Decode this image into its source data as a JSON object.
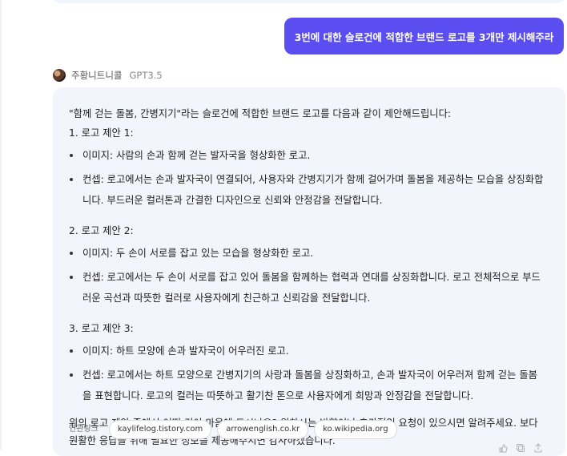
{
  "user_message": "3번에 대한 슬로건에 적합한 브랜드 로고를 3개만 제시해주라",
  "assistant": {
    "name": "주황니트니콜",
    "model": "GPT3.5"
  },
  "response": {
    "intro": "\"함께 걷는 돌봄, 간병지기\"라는 슬로건에 적합한 브랜드 로고를 다음과 같이 제안해드립니다:",
    "sections": [
      {
        "title": "1. 로고 제안 1:",
        "image": "이미지: 사람의 손과 함께 걷는 발자국을 형상화한 로고.",
        "concept": "컨셉: 로고에서는 손과 발자국이 연결되어, 사용자와 간병지기가 함께 걸어가며 돌봄을 제공하는 모습을 상징화합니다. 부드러운 컬러톤과 간결한 디자인으로 신뢰와 안정감을 전달합니다."
      },
      {
        "title": "2. 로고 제안 2:",
        "image": "이미지: 두 손이 서로를 잡고 있는 모습을 형상화한 로고.",
        "concept": "컨셉: 로고에서는 두 손이 서로를 잡고 있어 돌봄을 함께하는 협력과 연대를 상징화합니다. 로고 전체적으로 부드러운 곡선과 따뜻한 컬러로 사용자에게 친근하고 신뢰감을 전달합니다."
      },
      {
        "title": "3. 로고 제안 3:",
        "image": "이미지: 하트 모양에 손과 발자국이 어우러진 로고.",
        "concept": "컨셉: 로고에서는 하트 모양으로 간병지기의 사랑과 돌봄을 상징화하고, 손과 발자국이 어우러져 함께 걷는 돌봄을 표현합니다. 로고의 컬러는 따뜻하고 활기찬 톤으로 사용자에게 희망과 안정감을 전달합니다."
      }
    ],
    "closing": "위의 로고 제안 중에서 어떤 것이 마음에 드시나요? 원하시는 방향이나 추가적인 요청이 있으시면 알려주세요. 보다 원활한 응답을 위해 필요한 정보를 제공해주시면 감사하겠습니다."
  },
  "related_links": {
    "label": "연관링크",
    "items": [
      "kaylifelog.tistory.com",
      "arrowenglish.co.kr",
      "ko.wikipedia.org"
    ]
  },
  "colors": {
    "accent": "#5b4ef0",
    "bubble_bg": "#f2f5fb"
  },
  "icons": [
    "thumb-icon",
    "copy-icon",
    "share-icon"
  ]
}
